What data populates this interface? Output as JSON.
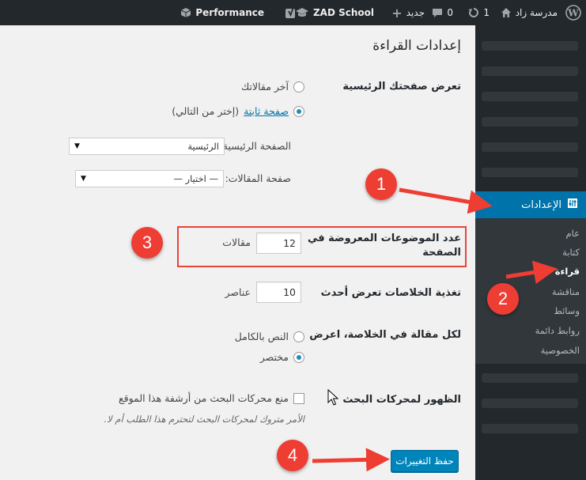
{
  "adminbar": {
    "wp_logo": "wordpress-logo-icon",
    "site_name": "مدرسة زاد",
    "updates_count": "1",
    "comments_count": "0",
    "new_label": "جديد",
    "school_label": "ZAD School",
    "performance_label": "Performance"
  },
  "sidebar": {
    "settings_label": "الإعدادات",
    "items": [
      {
        "label": "عام"
      },
      {
        "label": "كتابة"
      },
      {
        "label": "قراءة"
      },
      {
        "label": "مناقشة"
      },
      {
        "label": "وسائط"
      },
      {
        "label": "روابط دائمة"
      },
      {
        "label": "الخصوصية"
      }
    ]
  },
  "main": {
    "title": "إعدادات القراءة",
    "front_page": {
      "label": "تعرض صفحتك الرئيسية",
      "option_latest": "آخر مقالاتك",
      "option_static": "صفحة ثابتة",
      "option_static_hint": "(إختر من التالي)",
      "homepage_label": "الصفحة الرئيسية:",
      "homepage_value": "الرئيسية",
      "posts_page_label": "صفحة المقالات:",
      "posts_page_value": "— اختيار —"
    },
    "posts_per_page": {
      "label_line1": "عدد الموضوعات المعروضة في",
      "label_line2": "الصفحة",
      "value": "12",
      "unit": "مقالات"
    },
    "feed": {
      "label": "تغذية الخلاصات تعرض أحدث",
      "value": "10",
      "unit": "عناصر"
    },
    "feed_content": {
      "label": "لكل مقالة في الخلاصة، اعرض",
      "option_full": "النص بالكامل",
      "option_summary": "مختصر"
    },
    "search_visibility": {
      "label": "الظهور لمحركات البحث",
      "checkbox_label": "منع محركات البحث من أرشفة هذا الموقع",
      "description": "الأمر متروك لمحركات البحث لتحترم هذا الطلب أم لا."
    },
    "save_label": "حفظ التغييرات"
  },
  "annotations": {
    "callouts": [
      "1",
      "2",
      "3",
      "4"
    ],
    "color": "#ee3d33"
  }
}
